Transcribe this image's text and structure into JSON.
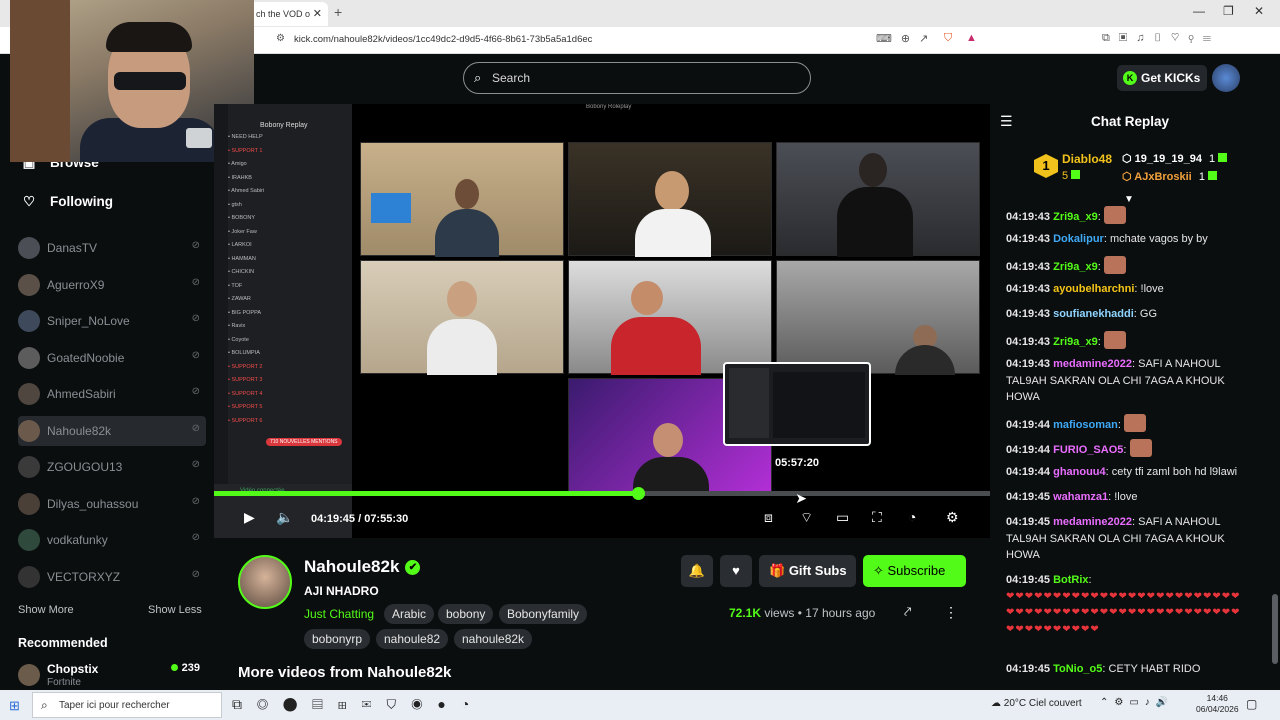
{
  "browser": {
    "tab_title": "ch the VOD o",
    "url": "kick.com/nahoule82k/videos/1cc49dc2-d9d5-4f66-8b61-73b5a5a1d6ec"
  },
  "header": {
    "search_placeholder": "Search",
    "get_kicks": "Get KICKs"
  },
  "sidebar": {
    "browse": "Browse",
    "following": "Following",
    "channels": [
      {
        "name": "DanasTV"
      },
      {
        "name": "AguerroX9"
      },
      {
        "name": "Sniper_NoLove"
      },
      {
        "name": "GoatedNoobie"
      },
      {
        "name": "AhmedSabiri"
      },
      {
        "name": "Nahoule82k"
      },
      {
        "name": "ZGOUGOU13"
      },
      {
        "name": "Dilyas_ouhassou"
      },
      {
        "name": "vodkafunky"
      },
      {
        "name": "VECTORXYZ"
      }
    ],
    "show_more": "Show More",
    "show_less": "Show Less",
    "recommended": "Recommended",
    "rec_channel": {
      "name": "Chopstix",
      "category": "Fortnite",
      "viewers": "239"
    }
  },
  "player": {
    "discord_title": "Bobony Replay",
    "screen_title": "Bobony Roleplay",
    "preview_time": "05:57:20",
    "progress": 0.546,
    "hover": 0.749,
    "time": "04:19:45 / 07:55:30",
    "discord_rows": [
      "NEED HELP",
      "SUPPORT 1",
      "Amigo",
      "IRAHKB",
      "Ahmed Sabiri",
      "gtsh",
      "BOBONY",
      "Joker Faw",
      "LARKOI",
      "HAMMAN",
      "CHICKIN",
      "TOF",
      "ZAWAR",
      "BIG POPPA",
      "Ravix",
      "Coyote",
      "BOLUMPIA",
      "SUPPORT 2",
      "SUPPORT 3",
      "SUPPORT 4",
      "SUPPORT 5",
      "SUPPORT 6"
    ],
    "discord_badge": "710 NOUVELLES MENTIONS",
    "discord_voice": "Vidéo connectée"
  },
  "info": {
    "channel_name": "Nahoule82k",
    "video_title": "AJI NHADRO",
    "category": "Just Chatting",
    "tags_row1": [
      "Arabic",
      "bobony",
      "Bobonyfamily"
    ],
    "tags_row2": [
      "bobonyrp",
      "nahoule82",
      "nahoule82k"
    ],
    "gift_subs": "Gift Subs",
    "subscribe": "Subscribe",
    "views_count": "72.1K",
    "views_label": "views",
    "age": "17 hours ago",
    "more_videos": "More videos from Nahoule82k"
  },
  "chat": {
    "title": "Chat Replay",
    "leader1": {
      "name": "Diablo48",
      "count": "5",
      "rank": "1"
    },
    "leader2": {
      "name": "19_19_19_94",
      "count": "1"
    },
    "leader3": {
      "name": "AJxBroskii",
      "count": "1"
    },
    "messages": [
      {
        "ts": "04:19:43",
        "user": "Zri9a_x9",
        "color": "#53fc18",
        "text": "",
        "emote": true
      },
      {
        "ts": "04:19:43",
        "user": "Dokalipur",
        "color": "#3fa9f5",
        "text": "mchate vagos by by"
      },
      {
        "ts": "04:19:43",
        "user": "Zri9a_x9",
        "color": "#53fc18",
        "text": "",
        "emote": true
      },
      {
        "ts": "04:19:43",
        "user": "ayoubelharchni",
        "color": "#f5c518",
        "text": "!love"
      },
      {
        "ts": "04:19:43",
        "user": "soufianekhaddi",
        "color": "#8fd3ff",
        "text": "GG"
      },
      {
        "ts": "04:19:43",
        "user": "Zri9a_x9",
        "color": "#53fc18",
        "text": "",
        "emote": true
      },
      {
        "ts": "04:19:43",
        "user": "medamine2022",
        "color": "#e96dff",
        "text": "SAFI A NAHOUL TAL9AH SAKRAN OLA CHI 7AGA A KHOUK HOWA"
      },
      {
        "ts": "04:19:44",
        "user": "mafiosoman",
        "color": "#3fa9f5",
        "text": "",
        "emote": true
      },
      {
        "ts": "04:19:44",
        "user": "FURIO_SAO5",
        "color": "#e96dff",
        "text": "",
        "emote": true
      },
      {
        "ts": "04:19:44",
        "user": "ghanouu4",
        "color": "#e96dff",
        "text": "cety tfi zaml boh hd l9lawi"
      },
      {
        "ts": "04:19:45",
        "user": "wahamza1",
        "color": "#e96dff",
        "text": "!love"
      },
      {
        "ts": "04:19:45",
        "user": "medamine2022",
        "color": "#e96dff",
        "text": "SAFI A NAHOUL TAL9AH SAKRAN OLA CHI 7AGA A KHOUK HOWA"
      },
      {
        "ts": "04:19:45",
        "user": "BotRix",
        "color": "#53fc18",
        "text": "hearts"
      },
      {
        "ts": "04:19:45",
        "user": "ToNio_o5",
        "color": "#53fc18",
        "text": "CETY HABT RIDO"
      }
    ]
  },
  "taskbar": {
    "search_placeholder": "Taper ici pour rechercher",
    "weather": "20°C Ciel couvert",
    "time": "14:46",
    "date": "06/04/2026"
  }
}
